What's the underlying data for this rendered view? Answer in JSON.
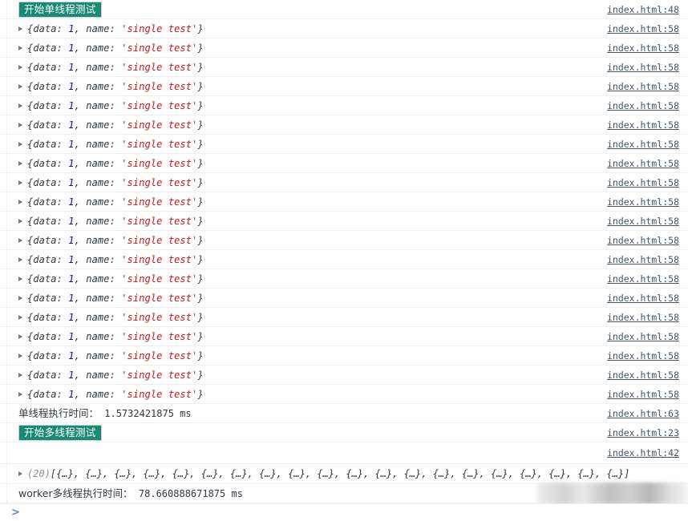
{
  "console": {
    "prompt_chevron": ">",
    "prompt_placeholder": "",
    "prompt_value": "",
    "accent_badge_color": "#1b8a75",
    "link_color": "#44546b",
    "string_color": "#c41a16",
    "number_color": "#1c00cf"
  },
  "messages": [
    {
      "kind": "badge",
      "text": "开始单线程测试",
      "link": "index.html:48"
    },
    {
      "kind": "object",
      "prefix": "{",
      "key1": "data:",
      "num": "1",
      "sep": ", ",
      "key2": "name:",
      "str": "'single test'",
      "suffix": "}",
      "link": "index.html:58"
    },
    {
      "kind": "object",
      "prefix": "{",
      "key1": "data:",
      "num": "1",
      "sep": ", ",
      "key2": "name:",
      "str": "'single test'",
      "suffix": "}",
      "link": "index.html:58"
    },
    {
      "kind": "object",
      "prefix": "{",
      "key1": "data:",
      "num": "1",
      "sep": ", ",
      "key2": "name:",
      "str": "'single test'",
      "suffix": "}",
      "link": "index.html:58"
    },
    {
      "kind": "object",
      "prefix": "{",
      "key1": "data:",
      "num": "1",
      "sep": ", ",
      "key2": "name:",
      "str": "'single test'",
      "suffix": "}",
      "link": "index.html:58"
    },
    {
      "kind": "object",
      "prefix": "{",
      "key1": "data:",
      "num": "1",
      "sep": ", ",
      "key2": "name:",
      "str": "'single test'",
      "suffix": "}",
      "link": "index.html:58"
    },
    {
      "kind": "object",
      "prefix": "{",
      "key1": "data:",
      "num": "1",
      "sep": ", ",
      "key2": "name:",
      "str": "'single test'",
      "suffix": "}",
      "link": "index.html:58"
    },
    {
      "kind": "object",
      "prefix": "{",
      "key1": "data:",
      "num": "1",
      "sep": ", ",
      "key2": "name:",
      "str": "'single test'",
      "suffix": "}",
      "link": "index.html:58"
    },
    {
      "kind": "object",
      "prefix": "{",
      "key1": "data:",
      "num": "1",
      "sep": ", ",
      "key2": "name:",
      "str": "'single test'",
      "suffix": "}",
      "link": "index.html:58"
    },
    {
      "kind": "object",
      "prefix": "{",
      "key1": "data:",
      "num": "1",
      "sep": ", ",
      "key2": "name:",
      "str": "'single test'",
      "suffix": "}",
      "link": "index.html:58"
    },
    {
      "kind": "object",
      "prefix": "{",
      "key1": "data:",
      "num": "1",
      "sep": ", ",
      "key2": "name:",
      "str": "'single test'",
      "suffix": "}",
      "link": "index.html:58"
    },
    {
      "kind": "object",
      "prefix": "{",
      "key1": "data:",
      "num": "1",
      "sep": ", ",
      "key2": "name:",
      "str": "'single test'",
      "suffix": "}",
      "link": "index.html:58"
    },
    {
      "kind": "object",
      "prefix": "{",
      "key1": "data:",
      "num": "1",
      "sep": ", ",
      "key2": "name:",
      "str": "'single test'",
      "suffix": "}",
      "link": "index.html:58"
    },
    {
      "kind": "object",
      "prefix": "{",
      "key1": "data:",
      "num": "1",
      "sep": ", ",
      "key2": "name:",
      "str": "'single test'",
      "suffix": "}",
      "link": "index.html:58"
    },
    {
      "kind": "object",
      "prefix": "{",
      "key1": "data:",
      "num": "1",
      "sep": ", ",
      "key2": "name:",
      "str": "'single test'",
      "suffix": "}",
      "link": "index.html:58"
    },
    {
      "kind": "object",
      "prefix": "{",
      "key1": "data:",
      "num": "1",
      "sep": ", ",
      "key2": "name:",
      "str": "'single test'",
      "suffix": "}",
      "link": "index.html:58"
    },
    {
      "kind": "object",
      "prefix": "{",
      "key1": "data:",
      "num": "1",
      "sep": ", ",
      "key2": "name:",
      "str": "'single test'",
      "suffix": "}",
      "link": "index.html:58"
    },
    {
      "kind": "object",
      "prefix": "{",
      "key1": "data:",
      "num": "1",
      "sep": ", ",
      "key2": "name:",
      "str": "'single test'",
      "suffix": "}",
      "link": "index.html:58"
    },
    {
      "kind": "object",
      "prefix": "{",
      "key1": "data:",
      "num": "1",
      "sep": ", ",
      "key2": "name:",
      "str": "'single test'",
      "suffix": "}",
      "link": "index.html:58"
    },
    {
      "kind": "object",
      "prefix": "{",
      "key1": "data:",
      "num": "1",
      "sep": ", ",
      "key2": "name:",
      "str": "'single test'",
      "suffix": "}",
      "link": "index.html:58"
    },
    {
      "kind": "object",
      "prefix": "{",
      "key1": "data:",
      "num": "1",
      "sep": ", ",
      "key2": "name:",
      "str": "'single test'",
      "suffix": "}",
      "link": "index.html:58"
    },
    {
      "kind": "plain",
      "cjk": "单线程执行时间：",
      "value": "1.5732421875 ms",
      "link": "index.html:63"
    },
    {
      "kind": "badge",
      "text": "开始多线程测试",
      "link": "index.html:23"
    },
    {
      "kind": "empty",
      "text": "",
      "link": "index.html:42"
    },
    {
      "kind": "array",
      "count": "(20)",
      "body": "[{…}, {…}, {…}, {…}, {…}, {…}, {…}, {…}, {…}, {…}, {…}, {…}, {…}, {…}, {…}, {…}, {…}, {…}, {…}, {…}]",
      "link": ""
    },
    {
      "kind": "plain-redacted",
      "cjk": "worker",
      "cjk2": "多线程执行时间：",
      "value": "78.660888671875 ms",
      "link": ""
    }
  ]
}
